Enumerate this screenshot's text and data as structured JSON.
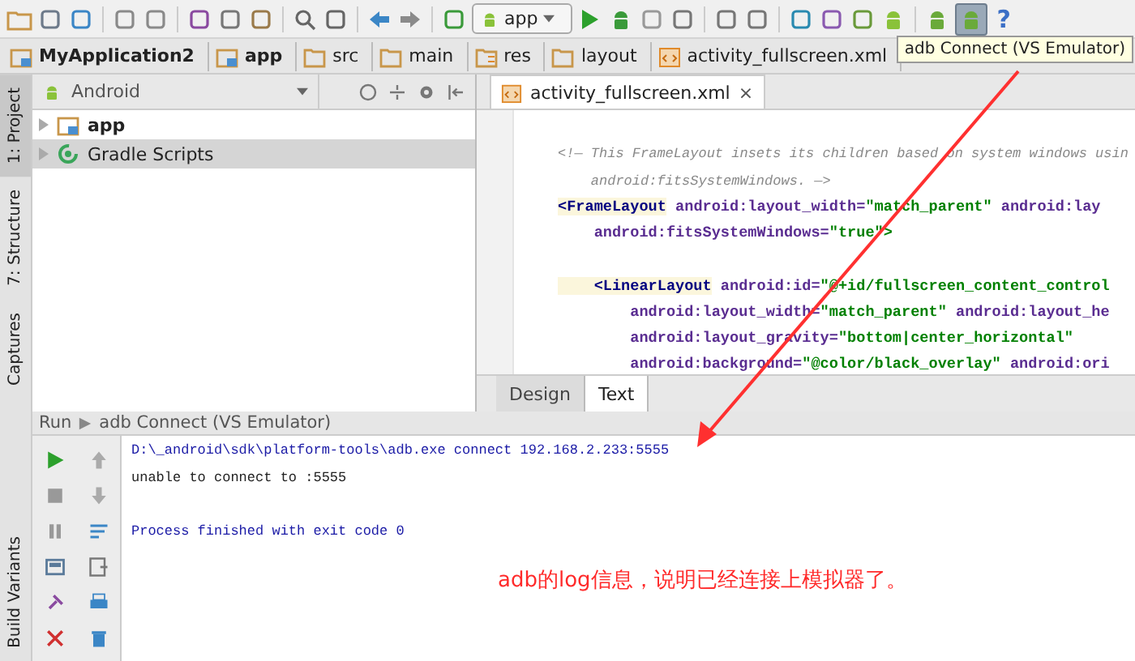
{
  "toolbar": {
    "run_config": "app",
    "help": "?"
  },
  "tooltip": "adb Connect (VS Emulator)",
  "breadcrumbs": [
    {
      "label": "MyApplication2",
      "kind": "module"
    },
    {
      "label": "app",
      "kind": "module"
    },
    {
      "label": "src",
      "kind": "folder"
    },
    {
      "label": "main",
      "kind": "folder"
    },
    {
      "label": "res",
      "kind": "res"
    },
    {
      "label": "layout",
      "kind": "folder"
    },
    {
      "label": "activity_fullscreen.xml",
      "kind": "xml"
    }
  ],
  "side_tabs": [
    {
      "label": "1: Project",
      "selected": true
    },
    {
      "label": "7: Structure",
      "selected": false
    },
    {
      "label": "Captures",
      "selected": false
    }
  ],
  "bottom_side_tabs": [
    {
      "label": "Build Variants",
      "selected": false
    }
  ],
  "project": {
    "view": "Android",
    "items": [
      {
        "label": "app",
        "kind": "module",
        "selected": false
      },
      {
        "label": "Gradle Scripts",
        "kind": "gradle",
        "selected": true
      }
    ]
  },
  "editor": {
    "tab": "activity_fullscreen.xml",
    "close": "×",
    "lines": [
      {
        "kind": "blank"
      },
      {
        "kind": "code",
        "parts": [
          {
            "kind": "comment",
            "text": "<!— This FrameLayout insets its children based on system windows usin"
          }
        ]
      },
      {
        "kind": "code",
        "parts": [
          {
            "kind": "comment",
            "text": "    android:fitsSystemWindows. —>"
          }
        ]
      },
      {
        "kind": "code",
        "parts": [
          {
            "kind": "tag",
            "text": "<FrameLayout"
          },
          {
            "kind": "attr",
            "text": " android:layout_width="
          },
          {
            "kind": "value",
            "text": "\"match_parent\""
          },
          {
            "kind": "attr",
            "text": " android:lay"
          }
        ]
      },
      {
        "kind": "code",
        "parts": [
          {
            "kind": "attr",
            "text": "    android:fitsSystemWindows="
          },
          {
            "kind": "value",
            "text": "\"true\">"
          }
        ]
      },
      {
        "kind": "blank"
      },
      {
        "kind": "code",
        "parts": [
          {
            "kind": "tag",
            "text": "    <LinearLayout"
          },
          {
            "kind": "attr",
            "text": " android:id="
          },
          {
            "kind": "value",
            "text": "\"@+id/fullscreen_content_control"
          }
        ]
      },
      {
        "kind": "code",
        "parts": [
          {
            "kind": "attr",
            "text": "        android:layout_width="
          },
          {
            "kind": "value",
            "text": "\"match_parent\""
          },
          {
            "kind": "attr",
            "text": " android:layout_he"
          }
        ]
      },
      {
        "kind": "code",
        "parts": [
          {
            "kind": "attr",
            "text": "        android:layout_gravity="
          },
          {
            "kind": "value",
            "text": "\"bottom|center_horizontal\""
          }
        ]
      },
      {
        "kind": "code",
        "parts": [
          {
            "kind": "attr",
            "text": "        android:background="
          },
          {
            "kind": "value",
            "text": "\"@color/black_overlay\""
          },
          {
            "kind": "attr",
            "text": " android:ori"
          }
        ]
      }
    ],
    "bottom_tabs": [
      {
        "label": "Design",
        "selected": false
      },
      {
        "label": "Text",
        "selected": true
      }
    ]
  },
  "run": {
    "label": "Run",
    "config": "adb Connect (VS Emulator)",
    "console": [
      {
        "kind": "command",
        "text": "D:\\_android\\sdk\\platform-tools\\adb.exe connect 192.168.2.233:5555"
      },
      {
        "kind": "output",
        "text": "unable to connect to :5555"
      },
      {
        "kind": "blank"
      },
      {
        "kind": "info",
        "text": "Process finished with exit code 0"
      }
    ]
  },
  "annotation": "adb的log信息，说明已经连接上模拟器了。"
}
